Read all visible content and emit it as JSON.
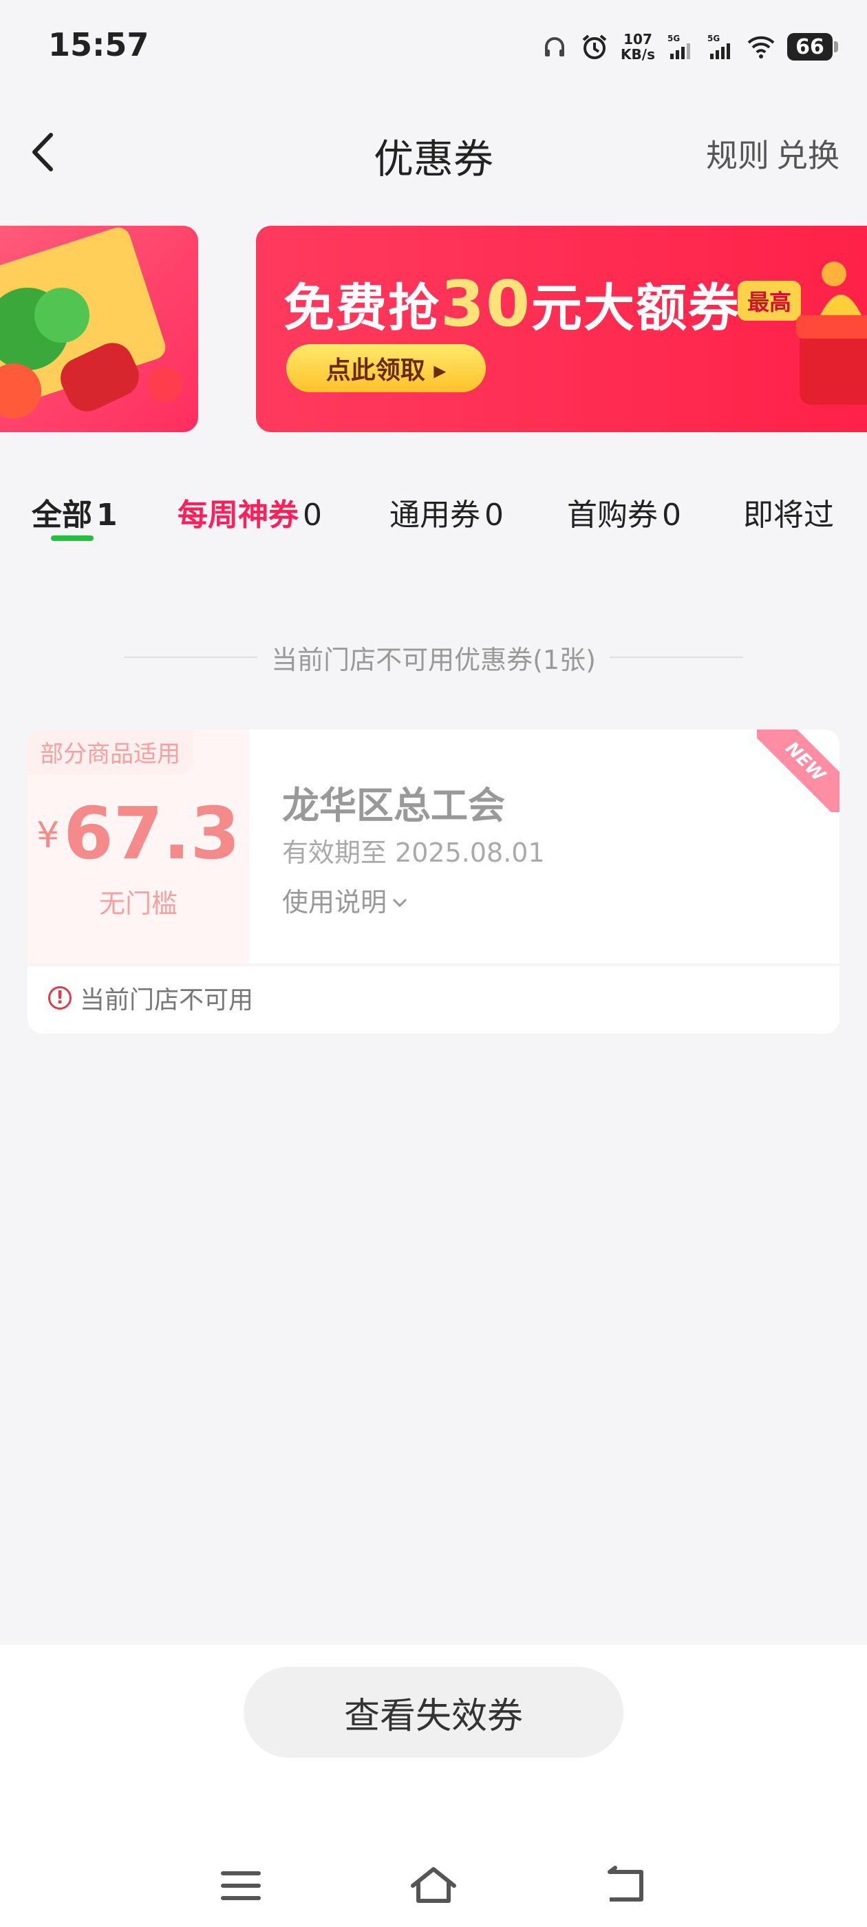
{
  "status_bar": {
    "time": "15:57",
    "net_speed_value": "107",
    "net_speed_unit": "KB/s",
    "signal1_label": "5G",
    "signal2_label": "5G",
    "battery": "66"
  },
  "header": {
    "title": "优惠券",
    "rule_label": "规则",
    "exchange_label": "兑换"
  },
  "banner": {
    "main_prefix": "免费抢",
    "main_amount": "30",
    "main_suffix": "元大额券",
    "badge": "最高",
    "button": "点此领取 ▸"
  },
  "tabs": [
    {
      "label": "全部",
      "count": "1"
    },
    {
      "label": "每周神券",
      "count": "0"
    },
    {
      "label": "通用券",
      "count": "0"
    },
    {
      "label": "首购券",
      "count": "0"
    },
    {
      "label": "即将过",
      "count": ""
    }
  ],
  "section_divider": "当前门店不可用优惠券(1张)",
  "coupon": {
    "scope_tag": "部分商品适用",
    "currency": "¥",
    "amount": "67.3",
    "threshold": "无门槛",
    "name": "龙华区总工会",
    "expiry": "有效期至 2025.08.01",
    "usage_label": "使用说明",
    "new_ribbon": "NEW",
    "unavailable_note": "当前门店不可用"
  },
  "bottom": {
    "expired_button": "查看失效券"
  },
  "colors": {
    "accent_green": "#23c03c",
    "accent_pink": "#ff1f5a",
    "coupon_price": "#f58a8a",
    "banner_red": "#ff2148"
  }
}
